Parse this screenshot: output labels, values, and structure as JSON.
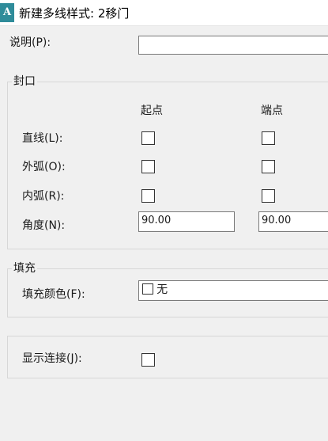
{
  "window": {
    "title": "新建多线样式: 2移门",
    "icon_label": "A"
  },
  "description": {
    "label": "说明(P):",
    "value": ""
  },
  "caps": {
    "group_title": "封口",
    "col_start": "起点",
    "col_end": "端点",
    "line_label": "直线(L):",
    "outer_arc_label": "外弧(O):",
    "inner_arc_label": "内弧(R):",
    "angle_label": "角度(N):",
    "angle_start": "90.00",
    "angle_end": "90.00",
    "line_start_checked": false,
    "line_end_checked": false,
    "outer_arc_start_checked": false,
    "outer_arc_end_checked": false,
    "inner_arc_start_checked": false,
    "inner_arc_end_checked": false
  },
  "fill": {
    "group_title": "填充",
    "color_label": "填充颜色(F):",
    "color_value": "无"
  },
  "joints": {
    "label": "显示连接(J):",
    "checked": false
  }
}
